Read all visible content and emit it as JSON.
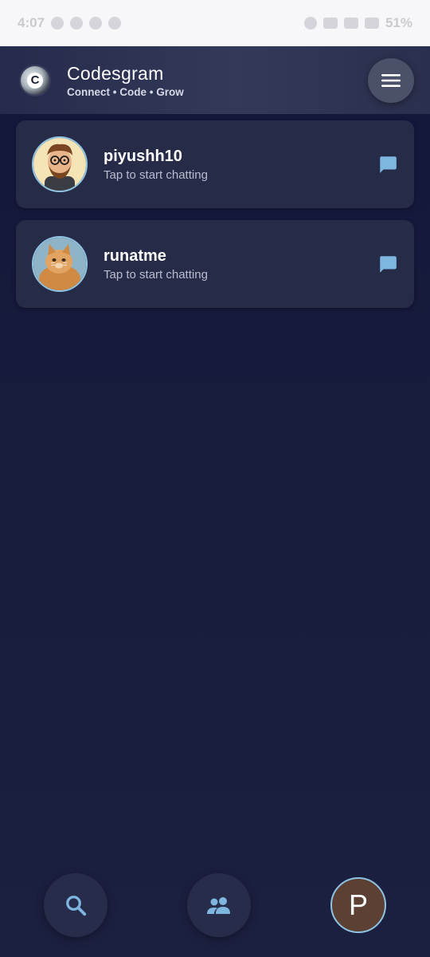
{
  "status_bar": {
    "time": "4:07",
    "battery": "51%"
  },
  "header": {
    "app_name": "Codesgram",
    "tagline": "Connect • Code • Grow",
    "logo_letter": "C",
    "menu_icon": "hamburger-menu-icon"
  },
  "chats": [
    {
      "username": "piyushh10",
      "subtitle": "Tap to start chatting",
      "avatar": "cartoon-man-avatar",
      "action_icon": "chat-bubble-icon"
    },
    {
      "username": "runatme",
      "subtitle": "Tap to start chatting",
      "avatar": "cat-photo-avatar",
      "action_icon": "chat-bubble-icon"
    }
  ],
  "bottom_nav": {
    "search_icon": "search-icon",
    "people_icon": "people-icon",
    "profile_initial": "P"
  },
  "colors": {
    "accent": "#7fb6e0",
    "card": "#262b48",
    "header": "#333957",
    "background": "#161a3a",
    "profile_bg": "#5c4033"
  }
}
